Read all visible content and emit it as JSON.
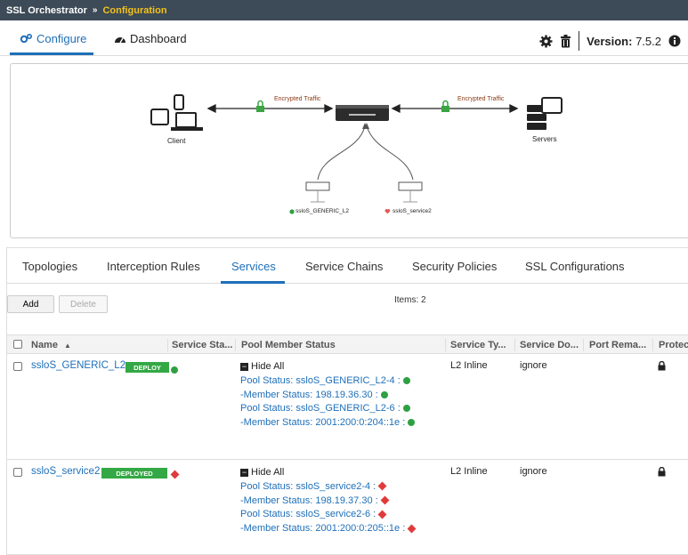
{
  "breadcrumb": {
    "app": "SSL Orchestrator",
    "separator": "»",
    "current": "Configuration"
  },
  "main_tabs": [
    {
      "label": "Configure",
      "active": true
    },
    {
      "label": "Dashboard",
      "active": false
    }
  ],
  "header": {
    "version_label": "Version:",
    "version_value": "7.5.2"
  },
  "topology": {
    "client_label": "Client",
    "servers_label": "Servers",
    "encrypted_left": "Encrypted Traffic",
    "encrypted_right": "Encrypted Traffic",
    "service1_label": "ssloS_GENERIC_L2",
    "service2_label": "ssloS_service2"
  },
  "sub_tabs": [
    {
      "label": "Topologies",
      "active": false
    },
    {
      "label": "Interception Rules",
      "active": false
    },
    {
      "label": "Services",
      "active": true
    },
    {
      "label": "Service Chains",
      "active": false
    },
    {
      "label": "Security Policies",
      "active": false
    },
    {
      "label": "SSL Configurations",
      "active": false
    }
  ],
  "toolbar": {
    "add_label": "Add",
    "delete_label": "Delete",
    "items_label": "Items: 2"
  },
  "table": {
    "columns": [
      "Name",
      "Service Sta...",
      "Pool Member Status",
      "Service Ty...",
      "Service Do...",
      "Port Rema...",
      "Protec"
    ],
    "rows": [
      {
        "name": "ssloS_GENERIC_L2",
        "badge": "DEPLOY",
        "hide_all": "Hide All",
        "pool_lines": [
          "Pool Status: ssloS_GENERIC_L2-4 :",
          "-Member Status: 198.19.36.30 :",
          "Pool Status: ssloS_GENERIC_L2-6 :",
          "-Member Status: 2001:200:0:204::1e :"
        ],
        "service_type": "L2 Inline",
        "service_down": "ignore"
      },
      {
        "name": "ssloS_service2",
        "badge": "DEPLOYED",
        "hide_all": "Hide All",
        "pool_lines": [
          "Pool Status: ssloS_service2-4 :",
          "-Member Status: 198.19.37.30 :",
          "Pool Status: ssloS_service2-6 :",
          "-Member Status: 2001:200:0:205::1e :"
        ],
        "service_type": "L2 Inline",
        "service_down": "ignore"
      }
    ]
  },
  "colors": {
    "accent": "#1e6fb8",
    "topbar": "#3d4a57",
    "crumb": "#f3c21b",
    "ok": "#2ea043",
    "error": "#e03b3b",
    "badge": "#34a844"
  }
}
